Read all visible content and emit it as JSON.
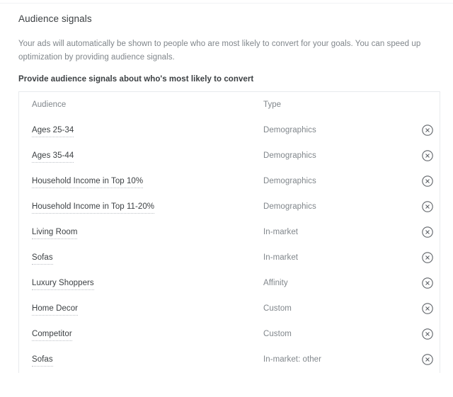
{
  "panel": {
    "title": "Audience signals",
    "description": "Your ads will automatically be shown to people who are most likely to convert for your goals. You can speed up optimization by providing audience signals.",
    "subtitle": "Provide audience signals about who's most likely to convert"
  },
  "table": {
    "columns": {
      "audience": "Audience",
      "type": "Type"
    },
    "remove_icon": "circle-x-icon",
    "rows": [
      {
        "audience": "Ages 25-34",
        "type": "Demographics"
      },
      {
        "audience": "Ages 35-44",
        "type": "Demographics"
      },
      {
        "audience": "Household Income in Top 10%",
        "type": "Demographics"
      },
      {
        "audience": "Household Income in Top 11-20%",
        "type": "Demographics"
      },
      {
        "audience": "Living Room",
        "type": "In-market"
      },
      {
        "audience": "Sofas",
        "type": "In-market"
      },
      {
        "audience": "Luxury Shoppers",
        "type": "Affinity"
      },
      {
        "audience": "Home Decor",
        "type": "Custom"
      },
      {
        "audience": "Competitor",
        "type": "Custom"
      },
      {
        "audience": "Sofas",
        "type": "In-market: other"
      }
    ]
  },
  "colors": {
    "text_primary": "#3c4043",
    "text_secondary": "#80868b",
    "border": "#e8eaed",
    "icon": "#5f6368",
    "background": "#ffffff"
  }
}
